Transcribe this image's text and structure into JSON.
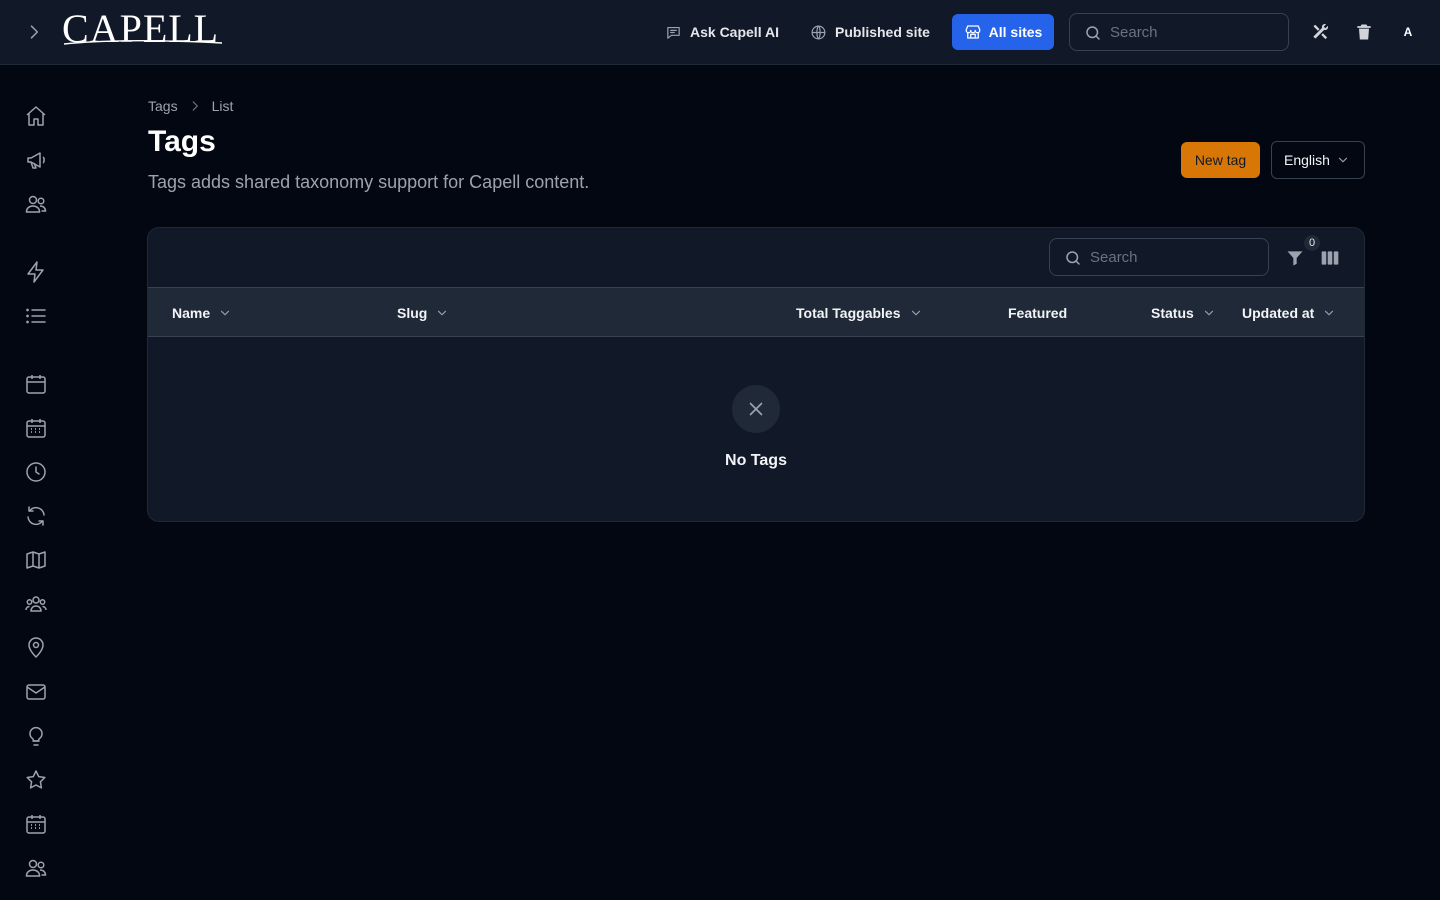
{
  "topbar": {
    "logo_text": "CAPELL",
    "ask_ai_label": "Ask Capell AI",
    "published_site_label": "Published site",
    "all_sites_label": "All sites",
    "search_placeholder": "Search",
    "avatar_initial": "A"
  },
  "sidebar": {
    "items": [
      {
        "icon": "home-icon"
      },
      {
        "icon": "megaphone-icon"
      },
      {
        "icon": "users-icon"
      },
      {
        "icon": "bolt-icon"
      },
      {
        "icon": "list-icon"
      },
      {
        "icon": "calendar-icon"
      },
      {
        "icon": "calendar-days-icon"
      },
      {
        "icon": "clock-icon"
      },
      {
        "icon": "refresh-icon"
      },
      {
        "icon": "map-icon"
      },
      {
        "icon": "user-group-icon"
      },
      {
        "icon": "map-pin-icon"
      },
      {
        "icon": "envelope-icon"
      },
      {
        "icon": "light-bulb-icon"
      },
      {
        "icon": "star-icon"
      },
      {
        "icon": "calendar-days-icon"
      },
      {
        "icon": "users-icon"
      }
    ]
  },
  "breadcrumb": {
    "items": [
      "Tags",
      "List"
    ]
  },
  "page": {
    "title": "Tags",
    "description": "Tags adds shared taxonomy support for Capell content.",
    "new_button_label": "New tag",
    "language_value": "English"
  },
  "table": {
    "search_placeholder": "Search",
    "filter_count": "0",
    "columns": [
      "Name",
      "Slug",
      "Total Taggables",
      "Featured",
      "Status",
      "Updated at"
    ],
    "empty_text": "No Tags"
  },
  "colors": {
    "background": "#030712",
    "topbar": "#111827",
    "accent_blue": "#2563eb",
    "accent_orange": "#d97706"
  }
}
